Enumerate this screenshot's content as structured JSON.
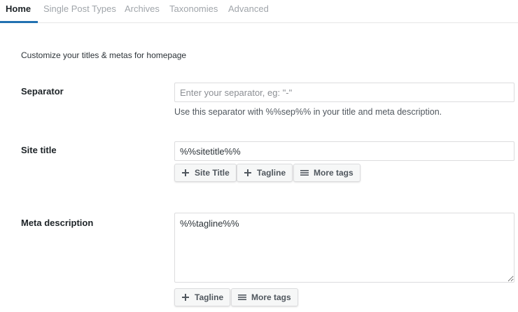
{
  "tabs": [
    {
      "label": "Home",
      "active": true
    },
    {
      "label": "Single Post Types",
      "active": false
    },
    {
      "label": "Archives",
      "active": false
    },
    {
      "label": "Taxonomies",
      "active": false
    },
    {
      "label": "Advanced",
      "active": false
    }
  ],
  "intro": "Customize your titles & metas for homepage",
  "separator": {
    "label": "Separator",
    "placeholder": "Enter your separator, eg: \"-\"",
    "value": "",
    "help": "Use this separator with %%sep%% in your title and meta description."
  },
  "site_title": {
    "label": "Site title",
    "value": "%%sitetitle%%",
    "buttons": [
      {
        "label": "Site Title",
        "icon": "plus-icon"
      },
      {
        "label": "Tagline",
        "icon": "plus-icon"
      },
      {
        "label": "More tags",
        "icon": "menu-icon"
      }
    ]
  },
  "meta_description": {
    "label": "Meta description",
    "value": "%%tagline%%",
    "buttons": [
      {
        "label": "Tagline",
        "icon": "plus-icon"
      },
      {
        "label": "More tags",
        "icon": "menu-icon"
      }
    ]
  },
  "colors": {
    "accent": "#2271b1",
    "text": "#1d2327",
    "muted_tab": "#a0a5aa",
    "border": "#dcdcde"
  }
}
